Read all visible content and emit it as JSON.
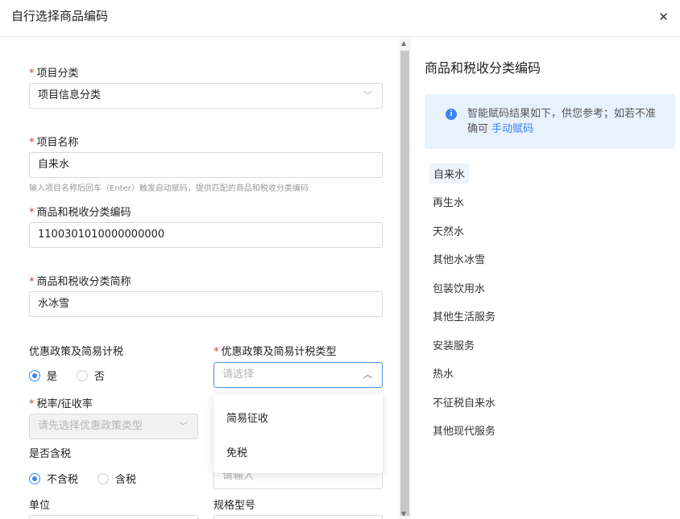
{
  "dialog": {
    "title": "自行选择商品编码",
    "close_icon": "close-icon"
  },
  "form": {
    "category": {
      "label": "项目分类",
      "value": "项目信息分类"
    },
    "item_name": {
      "label": "项目名称",
      "value": "自来水",
      "hint": "输入项目名称后回车（Enter）触发自动赋码，提供匹配的商品和税收分类编码"
    },
    "tax_code": {
      "label": "商品和税收分类编码",
      "value": "1100301010000000000"
    },
    "tax_short_name": {
      "label": "商品和税收分类简称",
      "value": "水冰雪"
    },
    "preferential": {
      "label": "优惠政策及简易计税",
      "options": [
        "是",
        "否"
      ],
      "selected": "是"
    },
    "preferential_type": {
      "label": "优惠政策及简易计税类型",
      "placeholder": "请选择",
      "options": [
        "简易征收",
        "免税"
      ]
    },
    "tax_rate": {
      "label": "税率/征收率",
      "placeholder": "请先选择优惠政策类型"
    },
    "tax_included": {
      "label": "是否含税",
      "options": [
        "不含税",
        "含税"
      ],
      "selected": "不含税"
    },
    "hidden_input_placeholder": "请输入",
    "unit": {
      "label": "单位"
    },
    "spec": {
      "label": "规格型号"
    }
  },
  "right_panel": {
    "title": "商品和税收分类编码",
    "info": {
      "text": "智能赋码结果如下，供您参考；如若不准确可",
      "link": "手动赋码"
    },
    "items": [
      "自来水",
      "再生水",
      "天然水",
      "其他水冰雪",
      "包装饮用水",
      "其他生活服务",
      "安装服务",
      "热水",
      "不征税自来水",
      "其他现代服务"
    ],
    "selected": "自来水"
  },
  "colors": {
    "accent": "#3b82f6",
    "required": "#e23a2e",
    "info_bg": "#e8f2fd"
  }
}
